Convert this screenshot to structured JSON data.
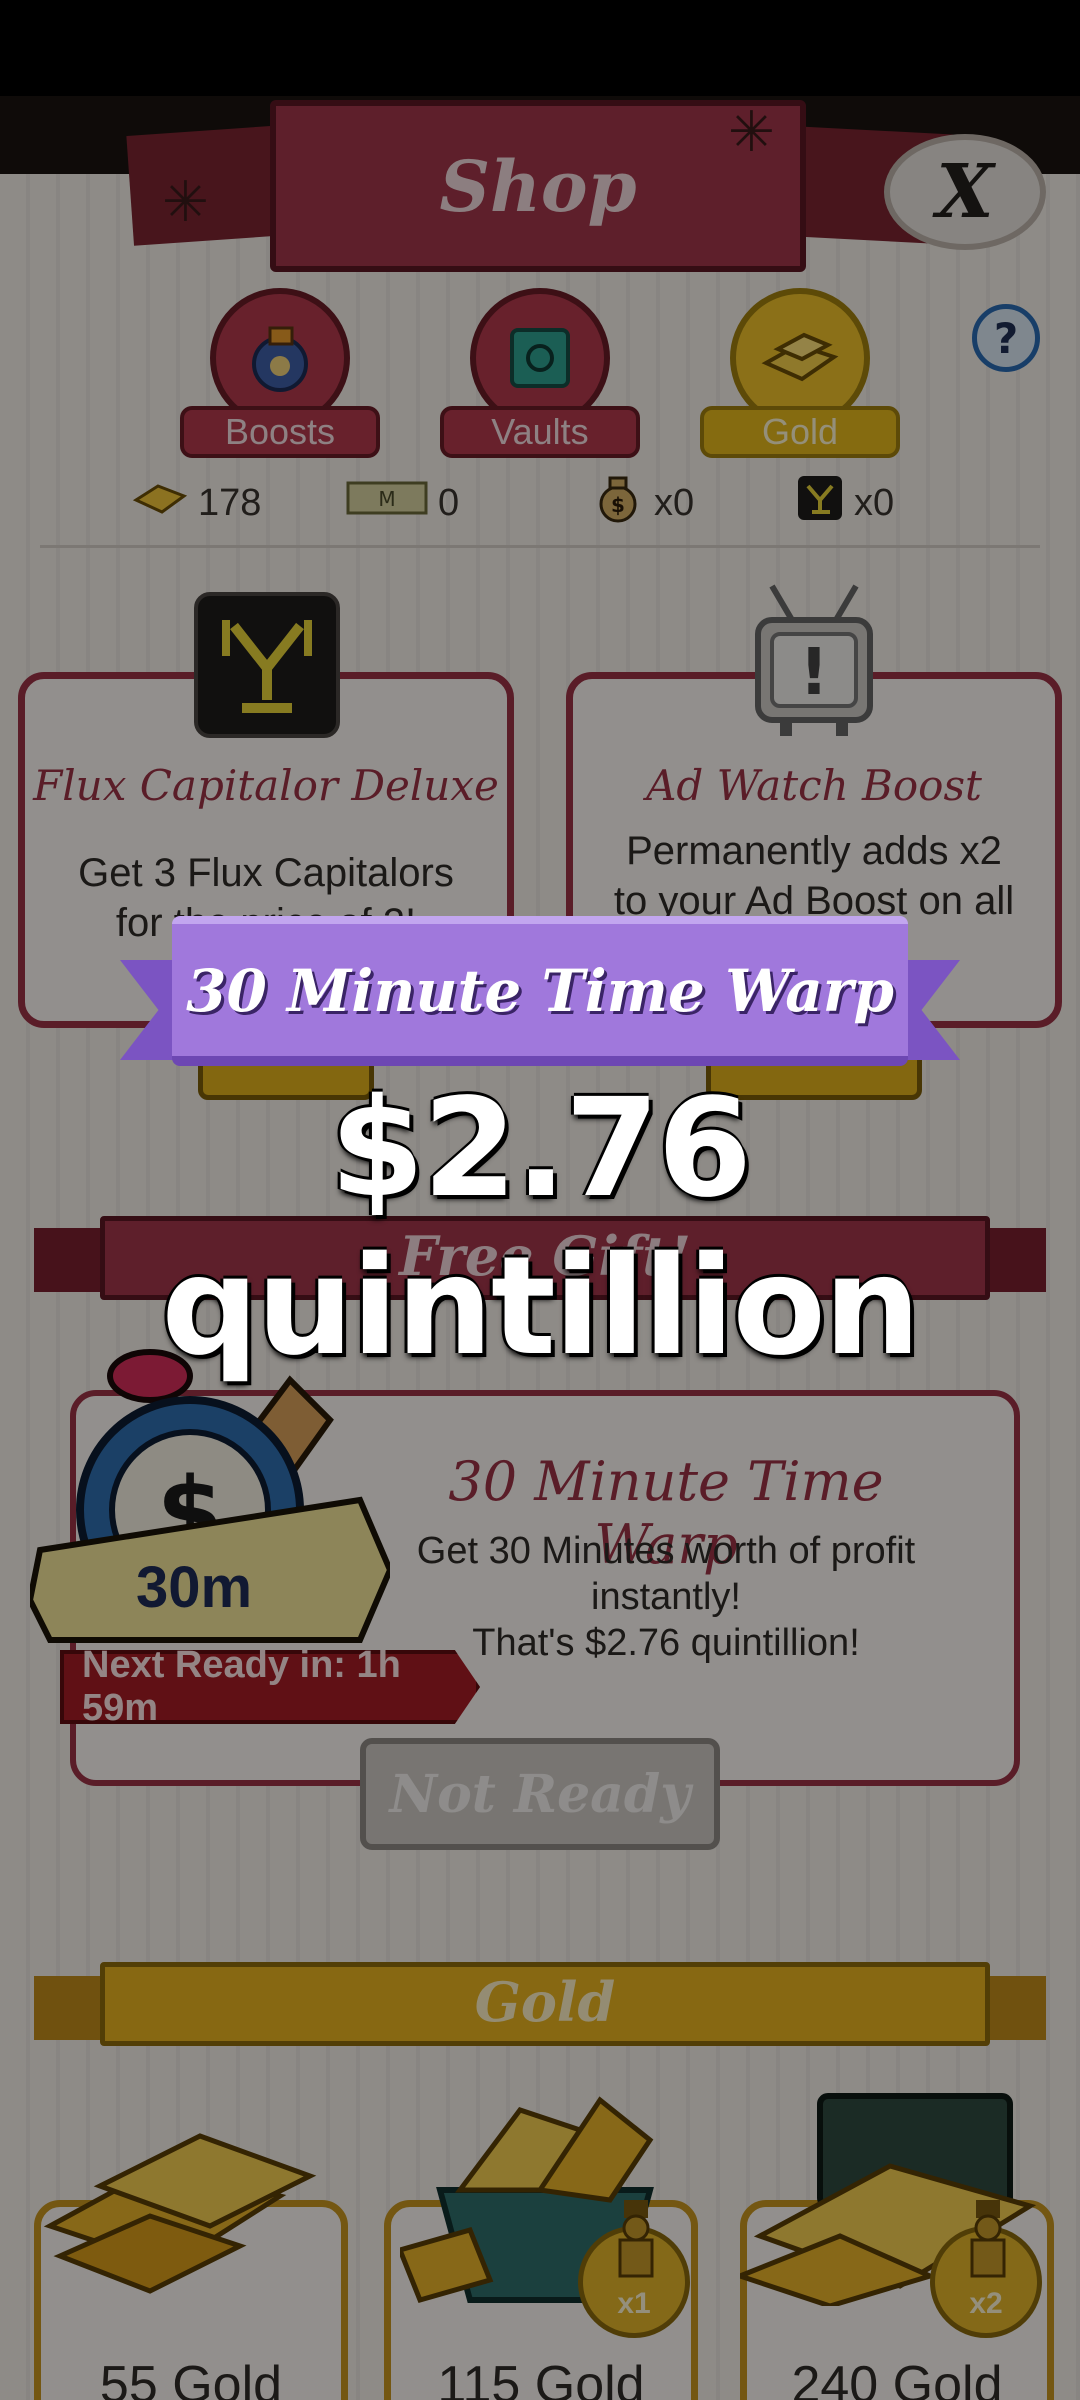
{
  "header": {
    "title": "Shop",
    "close_glyph": "X"
  },
  "tabs": [
    {
      "label": "Boosts",
      "icon": "boosts-bag-icon",
      "selected": false
    },
    {
      "label": "Vaults",
      "icon": "vault-safe-icon",
      "selected": false
    },
    {
      "label": "Gold",
      "icon": "gold-bars-icon",
      "selected": true
    }
  ],
  "help_glyph": "?",
  "currencies": [
    {
      "icon": "gold-bar-icon",
      "value": "178"
    },
    {
      "icon": "megabucks-icon",
      "value": "0"
    },
    {
      "icon": "money-bag-icon",
      "value": "x0"
    },
    {
      "icon": "flux-capitalor-icon",
      "value": "x0"
    }
  ],
  "offers": [
    {
      "title": "Flux Capitalor Deluxe",
      "desc1": "Get 3 Flux Capitalors",
      "desc2": "for the price of 2!"
    },
    {
      "title": "Ad Watch Boost",
      "desc1": "Permanently adds x2",
      "desc2": "to your Ad Boost on all"
    }
  ],
  "free_gift": {
    "banner": "Free Gift!",
    "badge": "30m",
    "title": "30 Minute Time Warp",
    "desc1": "Get 30 Minutes worth of profit",
    "desc2": "instantly!",
    "desc3": "That's $2.76 quintillion!",
    "next_ready": "Next Ready in: 1h 59m",
    "button": "Not Ready"
  },
  "gold_section": {
    "banner": "Gold",
    "products": [
      {
        "name": "55 Gold",
        "mult": ""
      },
      {
        "name": "115 Gold",
        "mult": "x1"
      },
      {
        "name": "240 Gold",
        "mult": "x2"
      }
    ]
  },
  "popup": {
    "ribbon": "30 Minute Time Warp",
    "amount": "$2.76 quintillion"
  },
  "colors": {
    "accent": "#a3364a",
    "gold": "#e8b41f",
    "ribbon": "#a078dc",
    "alert": "#a51d25"
  }
}
